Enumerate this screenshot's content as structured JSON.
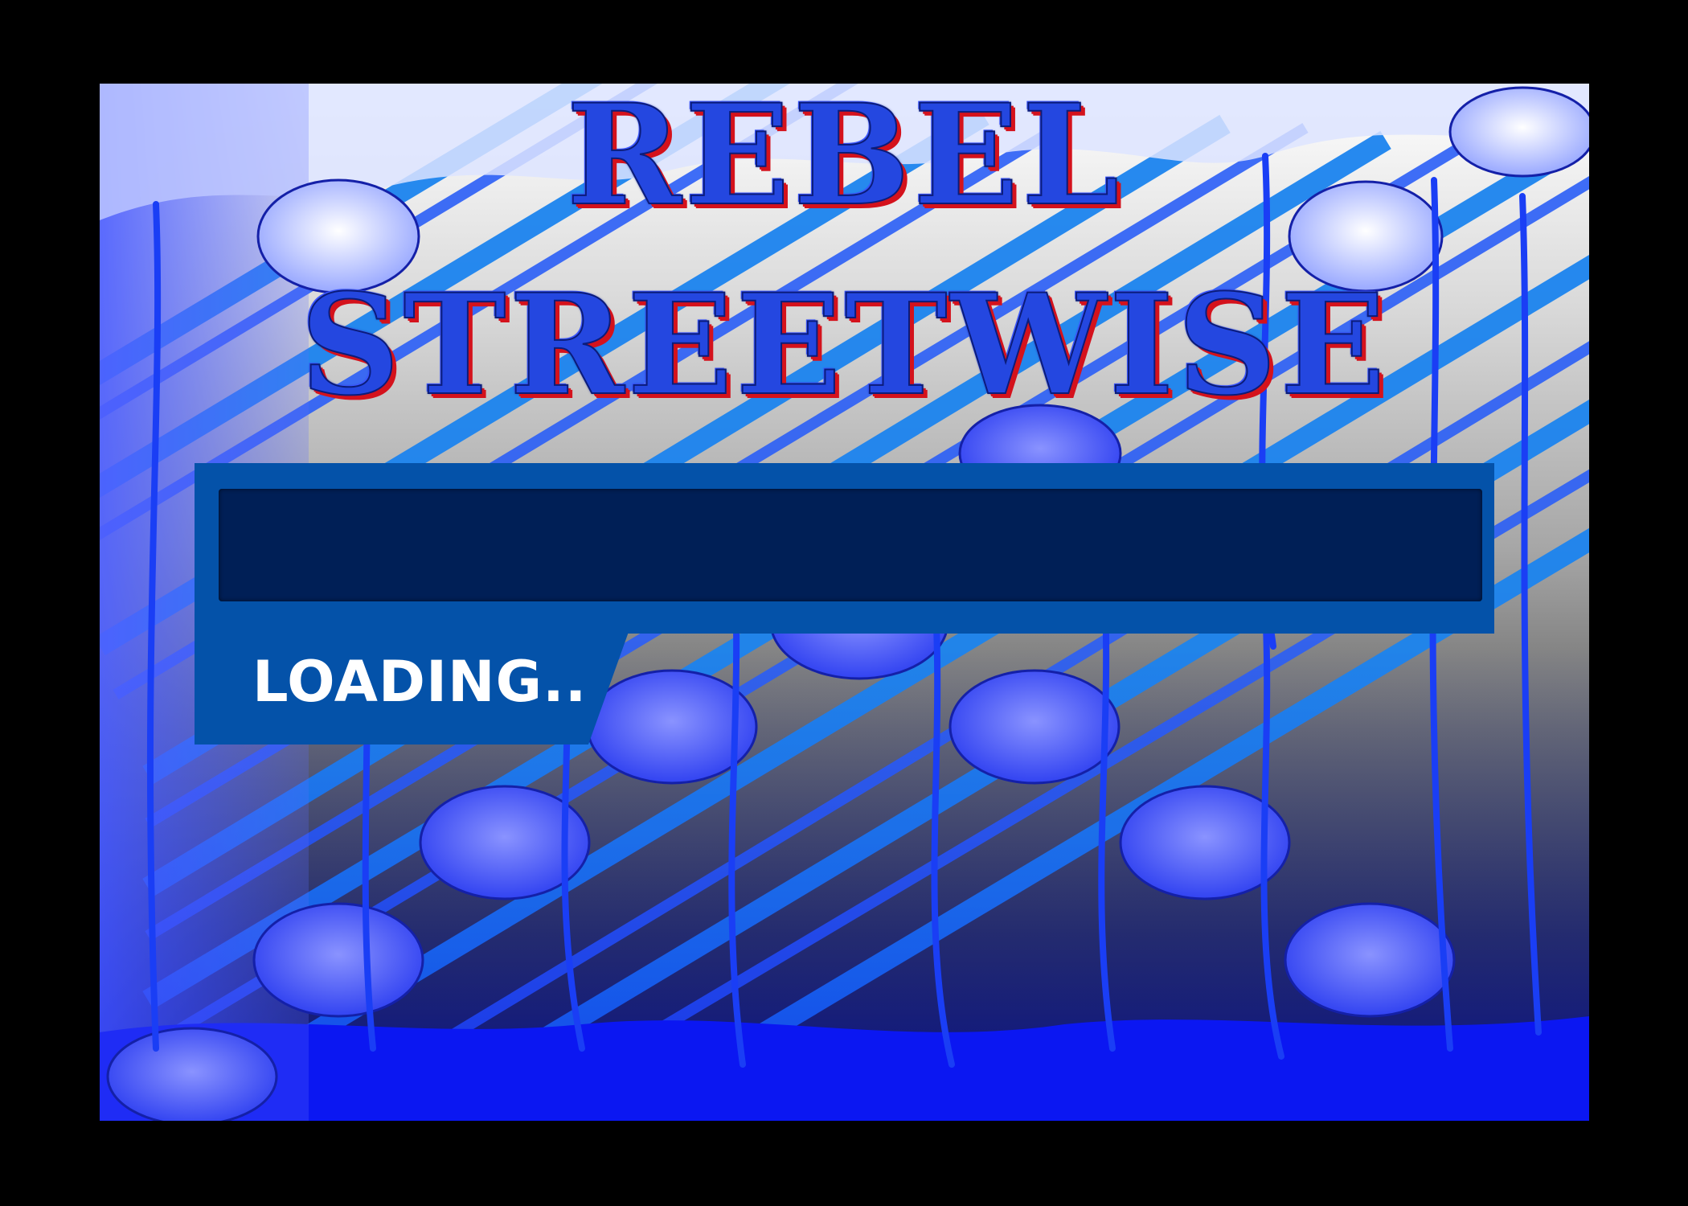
{
  "game": {
    "title_line1": "REBEL",
    "title_line2": "STREETWISE"
  },
  "loading": {
    "label": "LOADING..",
    "progress": 0
  },
  "colors": {
    "accent_blue": "#1a3ef5",
    "stripe_blue": "#1c84ef",
    "title_blue": "#2447e0",
    "title_shadow_red": "#d4121c",
    "bar_frame": "#0452a9",
    "bar_track": "#001f56",
    "label_text": "#ffffff"
  }
}
